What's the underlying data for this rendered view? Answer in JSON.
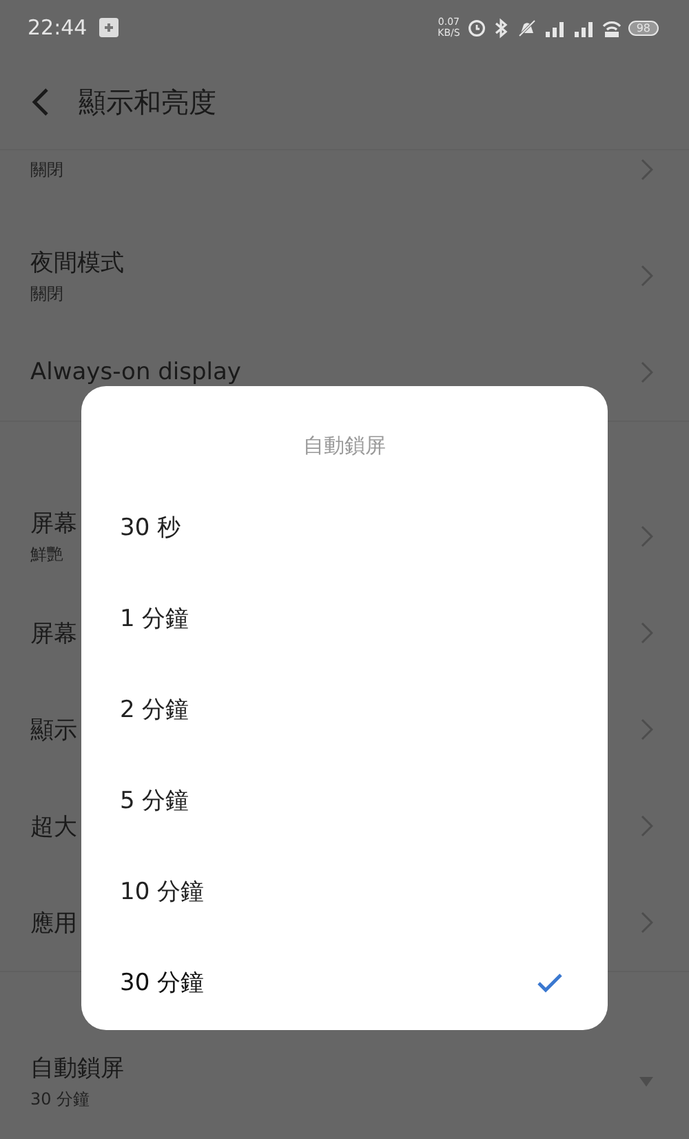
{
  "status_bar": {
    "time": "22:44",
    "speed_value": "0.07",
    "speed_unit": "KB/S",
    "battery": "98"
  },
  "header": {
    "title": "顯示和亮度"
  },
  "groups": [
    {
      "items": [
        {
          "sub": "關閉",
          "kind": "nav"
        },
        {
          "label": "夜間模式",
          "sub": "關閉",
          "kind": "nav"
        },
        {
          "label": "Always-on display",
          "kind": "nav"
        }
      ]
    },
    {
      "items": [
        {
          "label": "屏幕",
          "sub": "鮮艷",
          "kind": "nav"
        },
        {
          "label": "屏幕",
          "kind": "nav"
        },
        {
          "label": "顯示",
          "kind": "nav"
        },
        {
          "label": "超大",
          "kind": "nav"
        },
        {
          "label": "應用",
          "kind": "nav"
        }
      ]
    },
    {
      "items": [
        {
          "label": "自動鎖屏",
          "sub": "30 分鐘",
          "kind": "dropdown"
        }
      ]
    }
  ],
  "dialog": {
    "title": "自動鎖屏",
    "options": [
      {
        "label": "30 秒",
        "selected": false
      },
      {
        "label": "1 分鐘",
        "selected": false
      },
      {
        "label": "2 分鐘",
        "selected": false
      },
      {
        "label": "5 分鐘",
        "selected": false
      },
      {
        "label": "10 分鐘",
        "selected": false
      },
      {
        "label": "30 分鐘",
        "selected": true
      }
    ]
  }
}
